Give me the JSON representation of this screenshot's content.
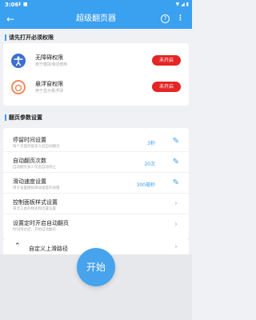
{
  "status_bar": {
    "time": "3:06",
    "left_icons": "⬇ ■",
    "right_icons": "▼ ◢ ▮"
  },
  "app_bar": {
    "back_icon": "←",
    "title": "超级翻页器",
    "help_icon": "?",
    "menu_icon": "⋮"
  },
  "permissions": {
    "section_title": "请先打开必须权限",
    "items": [
      {
        "label": "无障碍权限",
        "sub": "用于模拟滑动使用",
        "button": "未开启"
      },
      {
        "label": "悬浮窗权限",
        "sub": "用于显示悬浮球",
        "button": "未开启"
      }
    ]
  },
  "settings": {
    "section_title": "翻页参数设置",
    "items": [
      {
        "label": "停留时间设置",
        "sub": "每个页面停留多久后自动翻页",
        "value": "3秒"
      },
      {
        "label": "自动翻页次数",
        "sub": "自动翻页多少次后自动停止",
        "value": "20次"
      },
      {
        "label": "滑动速度设置",
        "sub": "用于设置模拟滑动速度的快慢",
        "value": "300毫秒"
      },
      {
        "label": "控制面板样式设置",
        "sub": "悬浮工具的样式和位置设置"
      },
      {
        "label": "设置定时开启自动翻页",
        "sub": "时间到达后，开始自动翻页"
      }
    ],
    "custom_path": {
      "label": "自定义上滑路径"
    }
  },
  "start_button": {
    "label": "开始"
  },
  "colors": {
    "accent": "#3aa0f0",
    "danger": "#e52525"
  }
}
